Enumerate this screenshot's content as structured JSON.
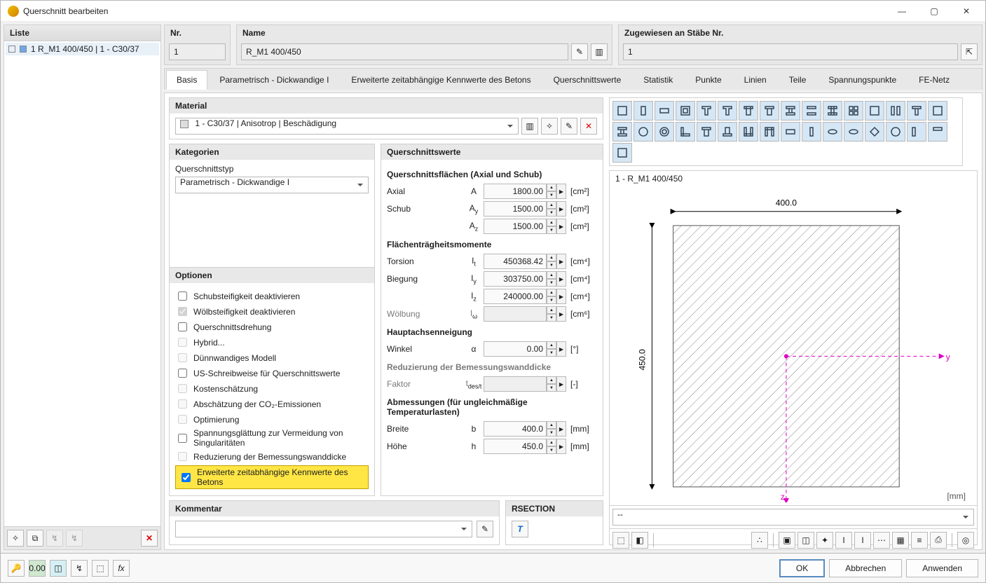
{
  "window": {
    "title": "Querschnitt bearbeiten"
  },
  "header": {
    "nr": {
      "label": "Nr.",
      "value": "1"
    },
    "name": {
      "label": "Name",
      "value": "R_M1 400/450"
    },
    "assigned": {
      "label": "Zugewiesen an Stäbe Nr.",
      "value": "1"
    }
  },
  "list": {
    "header": "Liste",
    "item": "1  R_M1 400/450 | 1 - C30/37"
  },
  "tabs": [
    "Basis",
    "Parametrisch - Dickwandige I",
    "Erweiterte zeitabhängige Kennwerte des Betons",
    "Querschnittswerte",
    "Statistik",
    "Punkte",
    "Linien",
    "Teile",
    "Spannungspunkte",
    "FE-Netz"
  ],
  "material": {
    "header": "Material",
    "value": "1 - C30/37 | Anisotrop | Beschädigung"
  },
  "kategorien": {
    "header": "Kategorien",
    "typ_label": "Querschnittstyp",
    "typ_value": "Parametrisch - Dickwandige I"
  },
  "optionen": {
    "header": "Optionen",
    "items": [
      {
        "label": "Schubsteifigkeit deaktivieren",
        "checked": false,
        "disabled": false
      },
      {
        "label": "Wölbsteifigkeit deaktivieren",
        "checked": true,
        "disabled": true
      },
      {
        "label": "Querschnittsdrehung",
        "checked": false,
        "disabled": false
      },
      {
        "label": "Hybrid...",
        "checked": false,
        "disabled": true
      },
      {
        "label": "Dünnwandiges Modell",
        "checked": false,
        "disabled": true
      },
      {
        "label": "US-Schreibweise für Querschnittswerte",
        "checked": false,
        "disabled": false
      },
      {
        "label": "Kostenschätzung",
        "checked": false,
        "disabled": true
      },
      {
        "label": "Abschätzung der CO₂-Emissionen",
        "checked": false,
        "disabled": true
      },
      {
        "label": "Optimierung",
        "checked": false,
        "disabled": true
      },
      {
        "label": "Spannungsglättung zur Vermeidung von Singularitäten",
        "checked": false,
        "disabled": false
      },
      {
        "label": "Reduzierung der Bemessungswanddicke",
        "checked": false,
        "disabled": true
      },
      {
        "label": "Erweiterte zeitabhängige Kennwerte des Betons",
        "checked": true,
        "disabled": false,
        "highlight": true
      }
    ]
  },
  "qswerte": {
    "header": "Querschnittswerte",
    "groups": {
      "flaechen": {
        "title": "Querschnittsflächen (Axial und Schub)",
        "rows": [
          {
            "label": "Axial",
            "sym": "A",
            "val": "1800.00",
            "unit": "[cm²]"
          },
          {
            "label": "Schub",
            "sym": "A_y",
            "val": "1500.00",
            "unit": "[cm²]"
          },
          {
            "label": "",
            "sym": "A_z",
            "val": "1500.00",
            "unit": "[cm²]"
          }
        ]
      },
      "traeg": {
        "title": "Flächenträgheitsmomente",
        "rows": [
          {
            "label": "Torsion",
            "sym": "I_t",
            "val": "450368.42",
            "unit": "[cm⁴]"
          },
          {
            "label": "Biegung",
            "sym": "I_y",
            "val": "303750.00",
            "unit": "[cm⁴]"
          },
          {
            "label": "",
            "sym": "I_z",
            "val": "240000.00",
            "unit": "[cm⁴]"
          },
          {
            "label": "Wölbung",
            "sym": "I_ω",
            "val": "",
            "unit": "[cm⁶]",
            "ro": true
          }
        ]
      },
      "haupt": {
        "title": "Hauptachsenneigung",
        "rows": [
          {
            "label": "Winkel",
            "sym": "α",
            "val": "0.00",
            "unit": "[°]"
          }
        ]
      },
      "reduz": {
        "title": "Reduzierung der Bemessungswanddicke",
        "rows": [
          {
            "label": "Faktor",
            "sym": "t_des/t",
            "val": "",
            "unit": "[-]",
            "ro": true
          }
        ]
      },
      "abm": {
        "title": "Abmessungen (für ungleichmäßige Temperaturlasten)",
        "rows": [
          {
            "label": "Breite",
            "sym": "b",
            "val": "400.0",
            "unit": "[mm]"
          },
          {
            "label": "Höhe",
            "sym": "h",
            "val": "450.0",
            "unit": "[mm]"
          }
        ]
      }
    }
  },
  "kommentar": {
    "header": "Kommentar"
  },
  "rsection": {
    "header": "RSECTION"
  },
  "preview": {
    "title": "1 - R_M1 400/450",
    "width": "400.0",
    "height": "450.0",
    "unit": "[mm]",
    "combo": "--"
  },
  "footer": {
    "ok": "OK",
    "cancel": "Abbrechen",
    "apply": "Anwenden"
  }
}
